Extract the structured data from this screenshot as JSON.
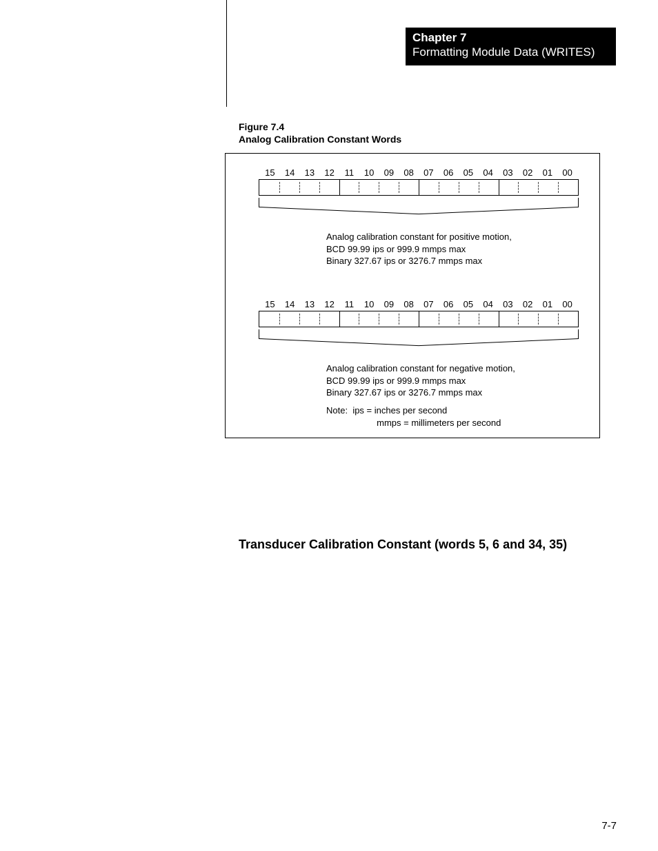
{
  "chapter": {
    "label": "Chapter 7",
    "subtitle": "Formatting Module Data (WRITES)"
  },
  "figure": {
    "number": "Figure 7.4",
    "title": "Analog Calibration Constant Words"
  },
  "bits": [
    "15",
    "14",
    "13",
    "12",
    "11",
    "10",
    "09",
    "08",
    "07",
    "06",
    "05",
    "04",
    "03",
    "02",
    "01",
    "00"
  ],
  "desc1": {
    "line1": "Analog calibration constant for positive motion,",
    "line2": "BCD 99.99 ips or 999.9 mmps max",
    "line3": "Binary 327.67 ips or 3276.7 mmps max"
  },
  "desc2": {
    "line1": "Analog calibration constant for negative motion,",
    "line2": "BCD 99.99 ips or 999.9 mmps max",
    "line3": "Binary 327.67 ips or 3276.7 mmps max"
  },
  "note": {
    "prefix": "Note:",
    "line1": "ips = inches per second",
    "line2": "mmps = millimeters per second"
  },
  "section_heading": "Transducer Calibration Constant (words 5, 6 and 34, 35)",
  "page_number": "7-7"
}
